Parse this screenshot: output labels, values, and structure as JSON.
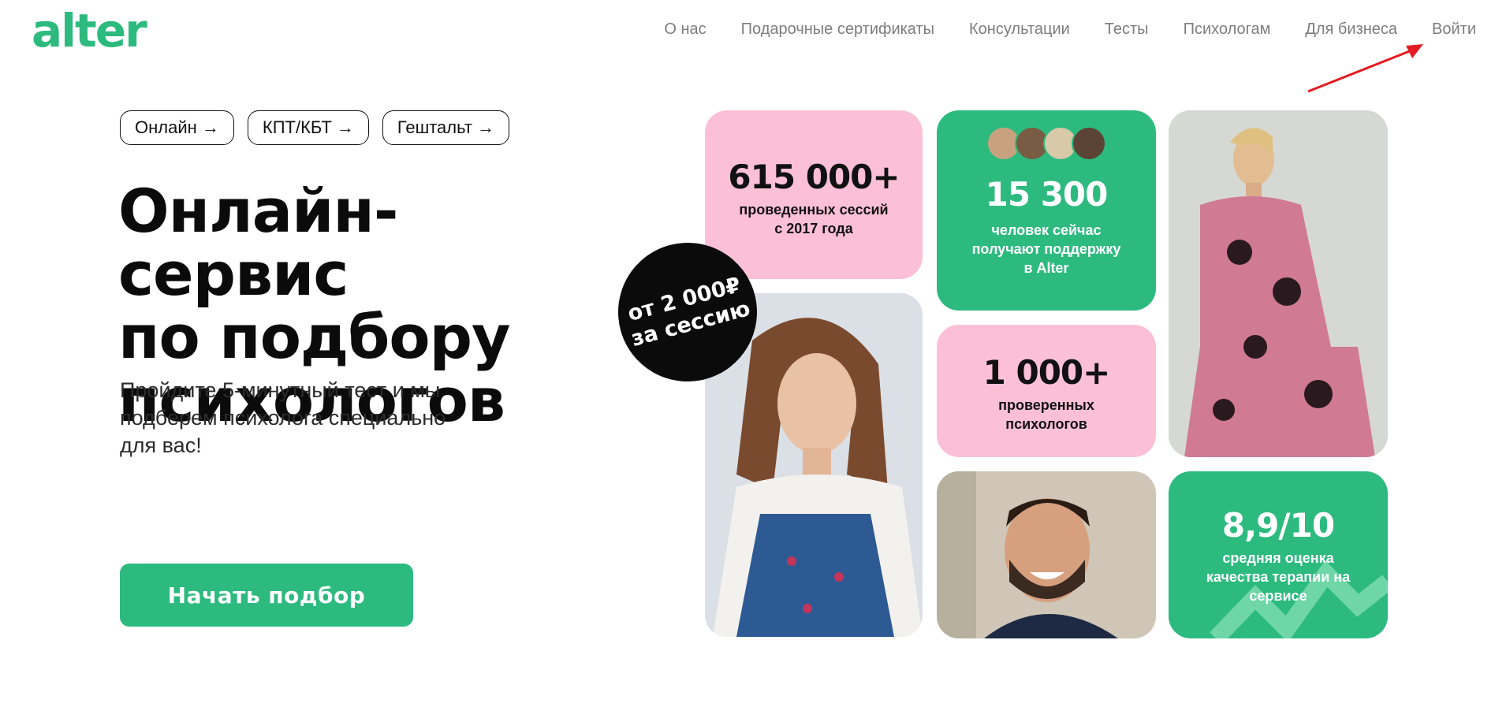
{
  "header": {
    "logo": "alter",
    "nav": [
      "О нас",
      "Подарочные сертификаты",
      "Консультации",
      "Тесты",
      "Психологам",
      "Для бизнеса",
      "Войти"
    ]
  },
  "chips": [
    "Онлайн →",
    "КПТ/КБТ →",
    "Гештальт →"
  ],
  "hero": {
    "title_lines": [
      "Онлайн-сервис",
      "по подбору",
      "психологов"
    ],
    "subtitle_lines": [
      "Пройдите 5-минутный тест и мы",
      "подберем психолога специально",
      "для вас!"
    ],
    "cta_label": "Начать подбор"
  },
  "badge": {
    "line1": "от 2 000₽",
    "line2": "за сессию"
  },
  "stats": {
    "sessions": {
      "value": "615 000+",
      "line1": "проведенных сессий",
      "line2": "с 2017 года"
    },
    "people": {
      "value": "15 300",
      "line1": "человек сейчас",
      "line2": "получают поддержку",
      "line3": "в Alter"
    },
    "psychologists": {
      "value": "1 000+",
      "line1": "проверенных",
      "line2": "психологов"
    },
    "rating": {
      "value": "8,9/10",
      "line1": "средняя оценка",
      "line2": "качества терапии на",
      "line3": "сервисе"
    }
  },
  "colors": {
    "brand_green": "#2dba7f",
    "pink": "#fcc0d6",
    "annotation_red": "#e31b23"
  }
}
